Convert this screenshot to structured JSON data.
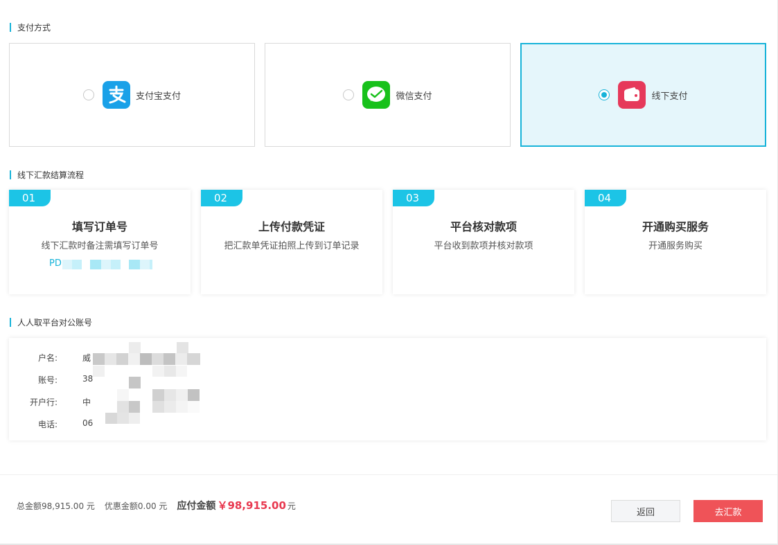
{
  "sections": {
    "payment_method": "支付方式",
    "offline_flow": "线下汇款结算流程",
    "platform_account": "人人取平台对公账号"
  },
  "payment_methods": [
    {
      "label": "支付宝支付",
      "icon": "alipay-icon",
      "color": "#1aa1e8",
      "selected": false
    },
    {
      "label": "微信支付",
      "icon": "wechat-icon",
      "color": "#18c11b",
      "selected": false
    },
    {
      "label": "线下支付",
      "icon": "wallet-icon",
      "color": "#e6395a",
      "selected": true
    }
  ],
  "steps": [
    {
      "num": "01",
      "title": "填写订单号",
      "desc": "线下汇款时备注需填写订单号",
      "order_prefix": "PD"
    },
    {
      "num": "02",
      "title": "上传付款凭证",
      "desc": "把汇款单凭证拍照上传到订单记录"
    },
    {
      "num": "03",
      "title": "平台核对款项",
      "desc": "平台收到款项并核对款项"
    },
    {
      "num": "04",
      "title": "开通购买服务",
      "desc": "开通服务购买"
    }
  ],
  "account": [
    {
      "label": "户名:",
      "value": "威"
    },
    {
      "label": "账号:",
      "value": "38"
    },
    {
      "label": "开户行:",
      "value": "中"
    },
    {
      "label": "电话:",
      "value": "06"
    }
  ],
  "summary": {
    "total": "总金额98,915.00 元",
    "discount": "优惠金额0.00 元",
    "pay_label": "应付金额",
    "pay_amount": "￥98,915.00",
    "pay_unit": "元"
  },
  "buttons": {
    "back": "返回",
    "remit": "去汇款"
  },
  "colors": {
    "accent": "#17b3d9",
    "step_badge": "#1cc4e6",
    "price": "#e8384f",
    "primary_button": "#ef5358"
  }
}
